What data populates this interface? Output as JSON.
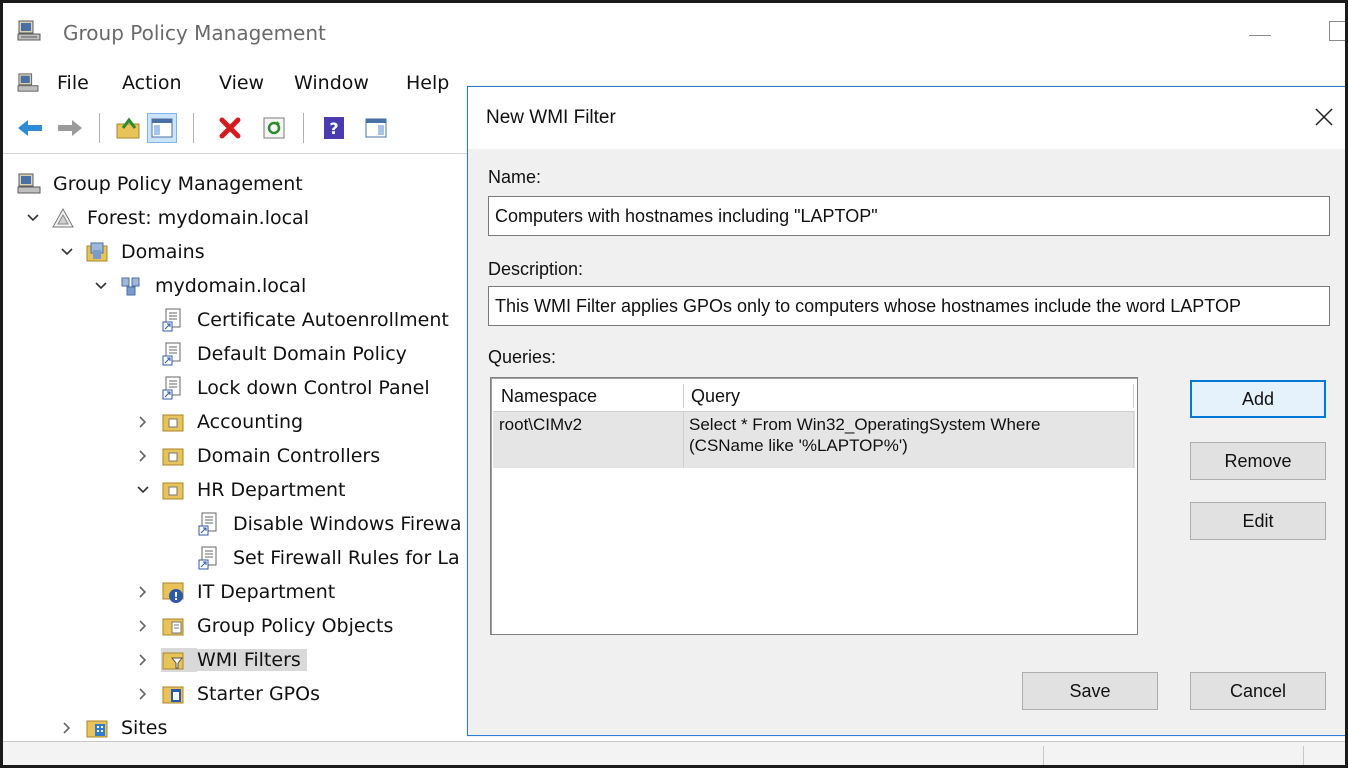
{
  "window": {
    "title": "Group Policy Management"
  },
  "menu": [
    "File",
    "Action",
    "View",
    "Window",
    "Help"
  ],
  "toolbar": {
    "icons": [
      "back-arrow-icon",
      "forward-arrow-icon",
      "up-folder-icon",
      "show-hide-console-tree-icon",
      "delete-icon",
      "refresh-icon",
      "help-icon",
      "show-action-pane-icon"
    ]
  },
  "tree": {
    "root": "Group Policy Management",
    "forest": "Forest: mydomain.local",
    "domains": "Domains",
    "domain": "mydomain.local",
    "gpo_links": [
      "Certificate Autoenrollment",
      "Default Domain Policy",
      "Lock down Control Panel"
    ],
    "ous": {
      "accounting": "Accounting",
      "domain_controllers": "Domain Controllers",
      "hr": "HR Department",
      "hr_children": [
        "Disable Windows Firewa",
        "Set Firewall Rules for La"
      ],
      "it": "IT Department",
      "gpo_objects": "Group Policy Objects",
      "wmi_filters": "WMI Filters",
      "starter_gpos": "Starter GPOs"
    },
    "sites": "Sites"
  },
  "dialog": {
    "title": "New WMI Filter",
    "name_label": "Name:",
    "name_value": "Computers with hostnames including \"LAPTOP\"",
    "description_label": "Description:",
    "description_value": "This WMI Filter applies GPOs only to computers whose hostnames include the word LAPTOP",
    "queries_label": "Queries:",
    "columns": [
      "Namespace",
      "Query"
    ],
    "query_row": {
      "namespace": "root\\CIMv2",
      "query_line1": "Select * From Win32_OperatingSystem Where",
      "query_line2": "(CSName like '%LAPTOP%')"
    },
    "buttons": {
      "add": "Add",
      "remove": "Remove",
      "edit": "Edit",
      "save": "Save",
      "cancel": "Cancel"
    }
  },
  "colors": {
    "accent": "#0078d7",
    "dialog_border": "#2d7bd4",
    "selection": "#d9d9d9"
  }
}
